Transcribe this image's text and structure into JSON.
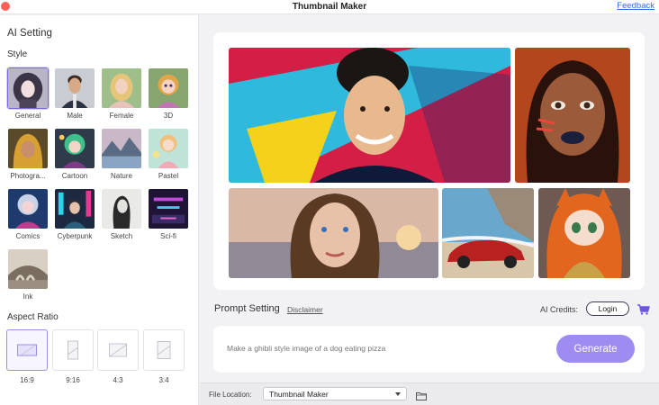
{
  "window": {
    "title": "Thumbnail Maker",
    "feedback_label": "Feedback"
  },
  "sidebar": {
    "heading": "AI Setting",
    "style_section": "Style",
    "styles": [
      {
        "label": "General",
        "selected": true
      },
      {
        "label": "Male",
        "selected": false
      },
      {
        "label": "Female",
        "selected": false
      },
      {
        "label": "3D",
        "selected": false
      },
      {
        "label": "Photogra...",
        "selected": false
      },
      {
        "label": "Cartoon",
        "selected": false
      },
      {
        "label": "Nature",
        "selected": false
      },
      {
        "label": "Pastel",
        "selected": false
      },
      {
        "label": "Comics",
        "selected": false
      },
      {
        "label": "Cyberpunk",
        "selected": false
      },
      {
        "label": "Sketch",
        "selected": false
      },
      {
        "label": "Sci-fi",
        "selected": false
      },
      {
        "label": "Ink",
        "selected": false
      }
    ],
    "aspect_section": "Aspect Ratio",
    "aspect_ratios": [
      {
        "label": "16:9",
        "selected": true
      },
      {
        "label": "9:16",
        "selected": false
      },
      {
        "label": "4:3",
        "selected": false
      },
      {
        "label": "3:4",
        "selected": false
      }
    ]
  },
  "preview": {
    "images": [
      "man-portrait",
      "woman-face-paint",
      "woman-sunset",
      "red-car-beach",
      "anime-girl"
    ]
  },
  "prompt": {
    "title": "Prompt Setting",
    "disclaimer": "Disclaimer",
    "credits_label": "AI Credits:",
    "login_label": "Login",
    "placeholder": "Make a ghibli style image of a dog eating pizza",
    "value": "",
    "generate_label": "Generate"
  },
  "bottom": {
    "file_location_label": "File Location:",
    "file_location_value": "Thumbnail Maker"
  },
  "colors": {
    "accent": "#9e8cf0",
    "link": "#2f6fe0",
    "close": "#fe5f57"
  }
}
